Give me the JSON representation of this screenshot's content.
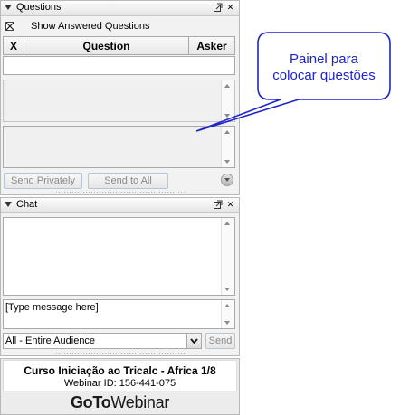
{
  "questions_panel": {
    "title": "Questions",
    "show_answered_label": "Show Answered Questions",
    "show_answered_checked": true,
    "columns": [
      "X",
      "Question",
      "Asker"
    ],
    "send_privately_label": "Send Privately",
    "send_to_all_label": "Send to All"
  },
  "chat_panel": {
    "title": "Chat",
    "input_value": "[Type message here]",
    "audience_selected": "All - Entire Audience",
    "send_label": "Send"
  },
  "footer": {
    "session_title": "Curso Iniciação ao Tricalc - Africa 1/8",
    "webinar_id": "Webinar ID: 156-441-075",
    "brand_goto": "GoTo",
    "brand_webinar": "Webinar"
  },
  "callout": {
    "text_line1": "Painel para",
    "text_line2": "colocar questões"
  },
  "icons": {
    "collapse": "triangle-down-icon",
    "popout": "popout-icon",
    "close": "close-icon",
    "dropdown": "chevron-down-icon"
  },
  "colors": {
    "callout_border": "#1f24c8",
    "callout_text": "#1f24c8",
    "button_border": "#b7c4d6"
  }
}
